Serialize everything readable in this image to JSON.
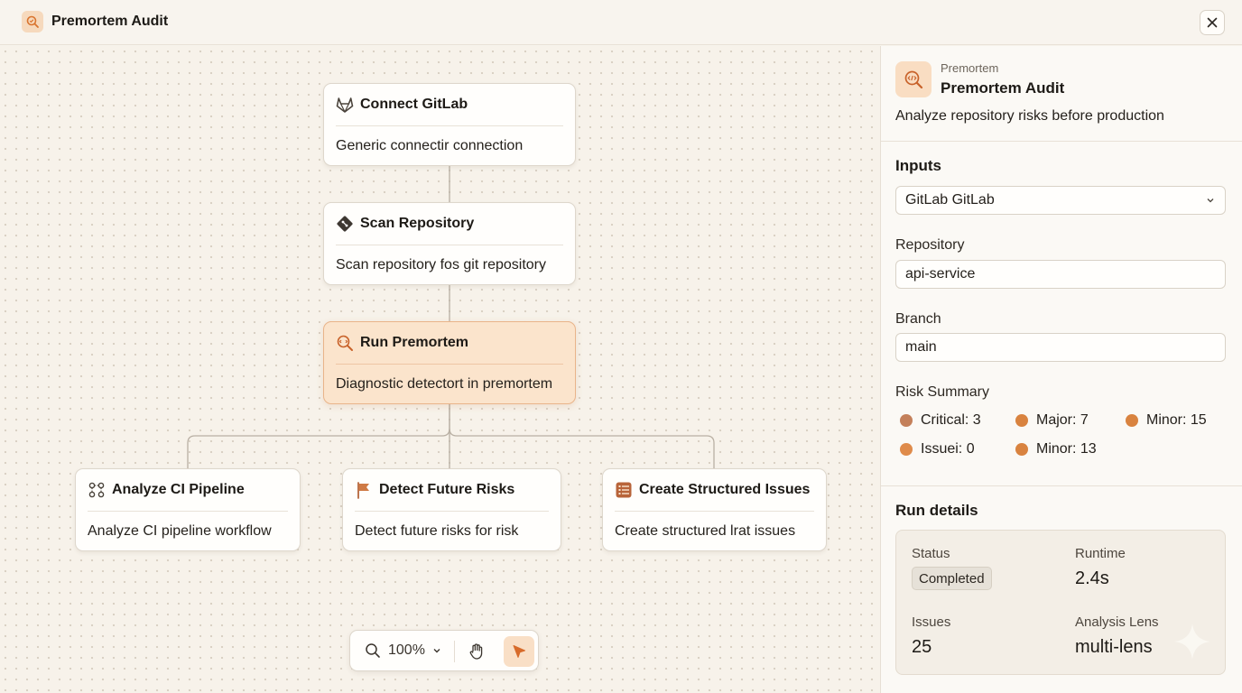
{
  "window": {
    "title": "Premortem Audit",
    "icon": "premortem-search-icon",
    "close_icon": "close-icon"
  },
  "workflow": {
    "nodes": {
      "connect": {
        "title": "Connect GitLab",
        "desc": "Generic connectir connection",
        "icon": "gitlab-icon"
      },
      "scan": {
        "title": "Scan Repository",
        "desc": "Scan repository fos git repository",
        "icon": "git-icon"
      },
      "run": {
        "title": "Run Premortem",
        "desc": "Diagnostic detectort in premortem",
        "icon": "premortem-icon"
      },
      "analyze": {
        "title": "Analyze CI Pipeline",
        "desc": "Analyze CI pipeline workflow",
        "icon": "pipeline-icon"
      },
      "detect": {
        "title": "Detect Future Risks",
        "desc": "Detect future risks for risk",
        "icon": "flag-icon"
      },
      "create": {
        "title": "Create Structured Issues",
        "desc": "Create structured lrat issues",
        "icon": "list-icon"
      }
    }
  },
  "toolbar": {
    "zoom": "100%",
    "zoom_icon": "search-icon",
    "hand_icon": "hand-icon",
    "select_icon": "pointer-icon"
  },
  "panel": {
    "kicker": "Premortem",
    "title": "Premortem Audit",
    "subtitle": "Analyze repository risks before production",
    "inputs_title": "Inputs",
    "connection_value": "GitLab GitLab",
    "repository_label": "Repository",
    "repository_value": "api-service",
    "branch_label": "Branch",
    "branch_value": "main",
    "risk_summary_title": "Risk Summary",
    "risks": [
      {
        "label": "Critical: 3",
        "color": "#c4805a"
      },
      {
        "label": "Major: 7",
        "color": "#d9833f"
      },
      {
        "label": "Minor: 15",
        "color": "#d9833f"
      },
      {
        "label": "Issuei: 0",
        "color": "#df8b4a"
      },
      {
        "label": "Minor: 13",
        "color": "#d9833f"
      }
    ],
    "run_details_title": "Run details",
    "run": {
      "status_label": "Status",
      "status_value": "Completed",
      "runtime_label": "Runtime",
      "runtime_value": "2.4s",
      "issues_label": "Issues",
      "issues_value": "25",
      "lens_label": "Analysis Lens",
      "lens_value": "multi-lens"
    }
  },
  "colors": {
    "accent": "#e07a3a",
    "active_node": "#fbe4cc",
    "background": "#f7f2ea"
  }
}
